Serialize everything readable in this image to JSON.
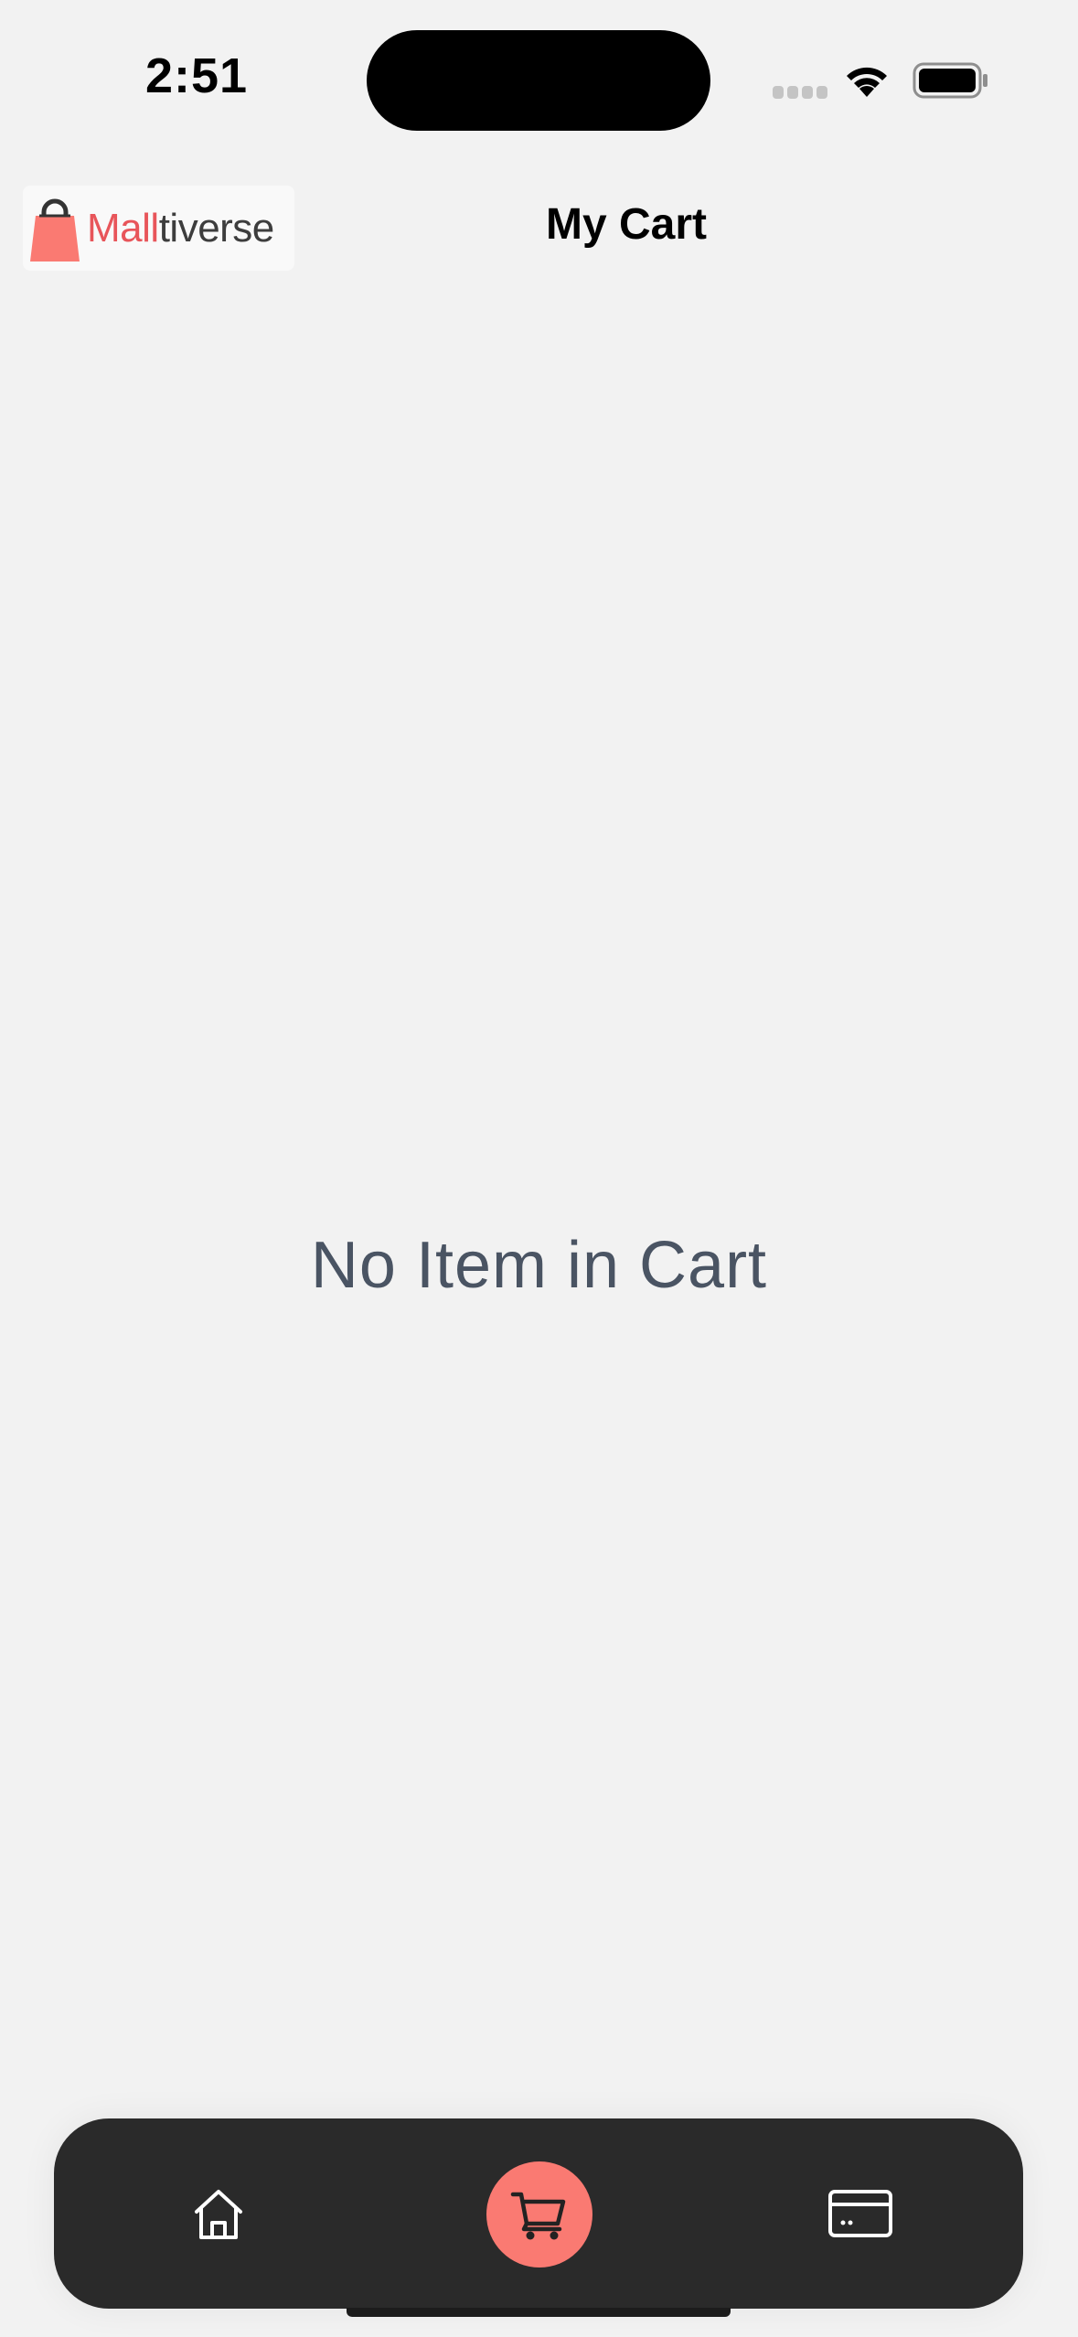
{
  "status_bar": {
    "time": "2:51",
    "signal_icon": "cellular-signal-icon",
    "wifi_icon": "wifi-icon",
    "battery_icon": "battery-icon"
  },
  "header": {
    "logo": {
      "part1": "Mall",
      "part2": "tiverse",
      "icon": "shopping-bag-icon"
    },
    "title": "My Cart"
  },
  "main": {
    "empty_message": "No Item in Cart"
  },
  "bottom_nav": {
    "items": [
      {
        "name": "home",
        "icon": "home-icon",
        "active": false
      },
      {
        "name": "cart",
        "icon": "cart-icon",
        "active": true
      },
      {
        "name": "payments",
        "icon": "credit-card-icon",
        "active": false
      }
    ]
  },
  "colors": {
    "background": "#f2f2f2",
    "nav_background": "#2a2a2a",
    "accent": "#fa7a72",
    "brand_red": "#e8555a",
    "empty_text": "#4a5463"
  }
}
